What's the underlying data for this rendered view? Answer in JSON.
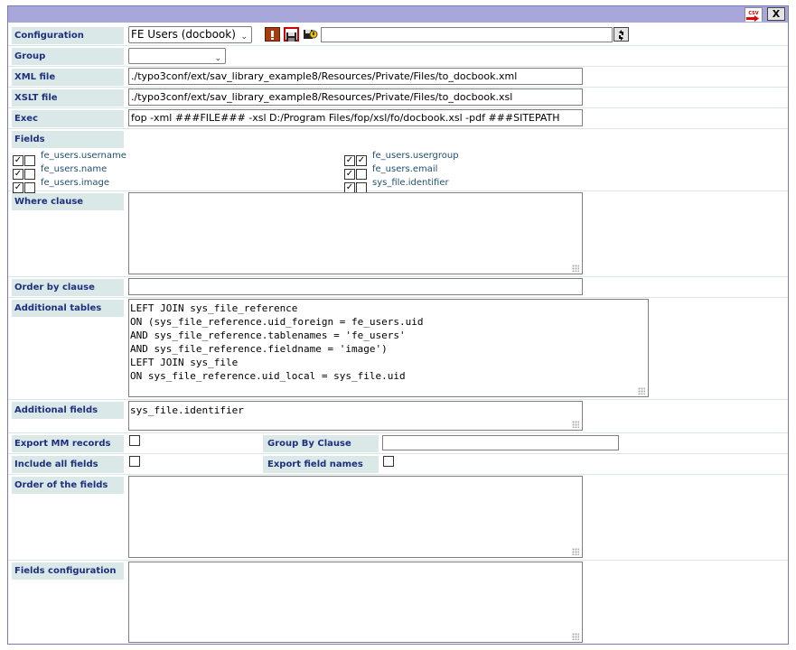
{
  "window": {
    "csv_label": "CSV",
    "close_label": "X"
  },
  "config": {
    "label": "Configuration",
    "selected": "FE Users (docbook)",
    "search_value": ""
  },
  "group": {
    "label": "Group",
    "selected": ""
  },
  "xml_file": {
    "label": "XML file",
    "value": "./typo3conf/ext/sav_library_example8/Resources/Private/Files/to_docbook.xml"
  },
  "xslt_file": {
    "label": "XSLT file",
    "value": "./typo3conf/ext/sav_library_example8/Resources/Private/Files/to_docbook.xsl"
  },
  "exec": {
    "label": "Exec",
    "value": "fop -xml ###FILE### -xsl D:/Program Files/fop/xsl/fo/docbook.xsl -pdf ###SITEPATH"
  },
  "fields": {
    "label": "Fields",
    "left": [
      {
        "name": "fe_users.username",
        "checked": false
      },
      {
        "name": "fe_users.name",
        "checked": false
      },
      {
        "name": "fe_users.image",
        "checked": false
      }
    ],
    "right": [
      {
        "name": "fe_users.usergroup",
        "checked": true
      },
      {
        "name": "fe_users.email",
        "checked": false
      },
      {
        "name": "sys_file.identifier",
        "checked": false
      }
    ]
  },
  "where_clause": {
    "label": "Where clause",
    "value": ""
  },
  "order_by": {
    "label": "Order by clause",
    "value": ""
  },
  "additional_tables": {
    "label": "Additional tables",
    "value": "LEFT JOIN sys_file_reference\nON (sys_file_reference.uid_foreign = fe_users.uid\nAND sys_file_reference.tablenames = 'fe_users'\nAND sys_file_reference.fieldname = 'image')\nLEFT JOIN sys_file\nON sys_file_reference.uid_local = sys_file.uid"
  },
  "additional_fields": {
    "label": "Additional fields",
    "value": "sys_file.identifier"
  },
  "export_mm": {
    "label": "Export MM records",
    "checked": false
  },
  "group_by": {
    "label": "Group By Clause",
    "value": ""
  },
  "include_all": {
    "label": "Include all fields",
    "checked": false
  },
  "export_names": {
    "label": "Export field names",
    "checked": false
  },
  "order_fields": {
    "label": "Order of the fields",
    "value": ""
  },
  "fields_config": {
    "label": "Fields configuration",
    "value": ""
  }
}
